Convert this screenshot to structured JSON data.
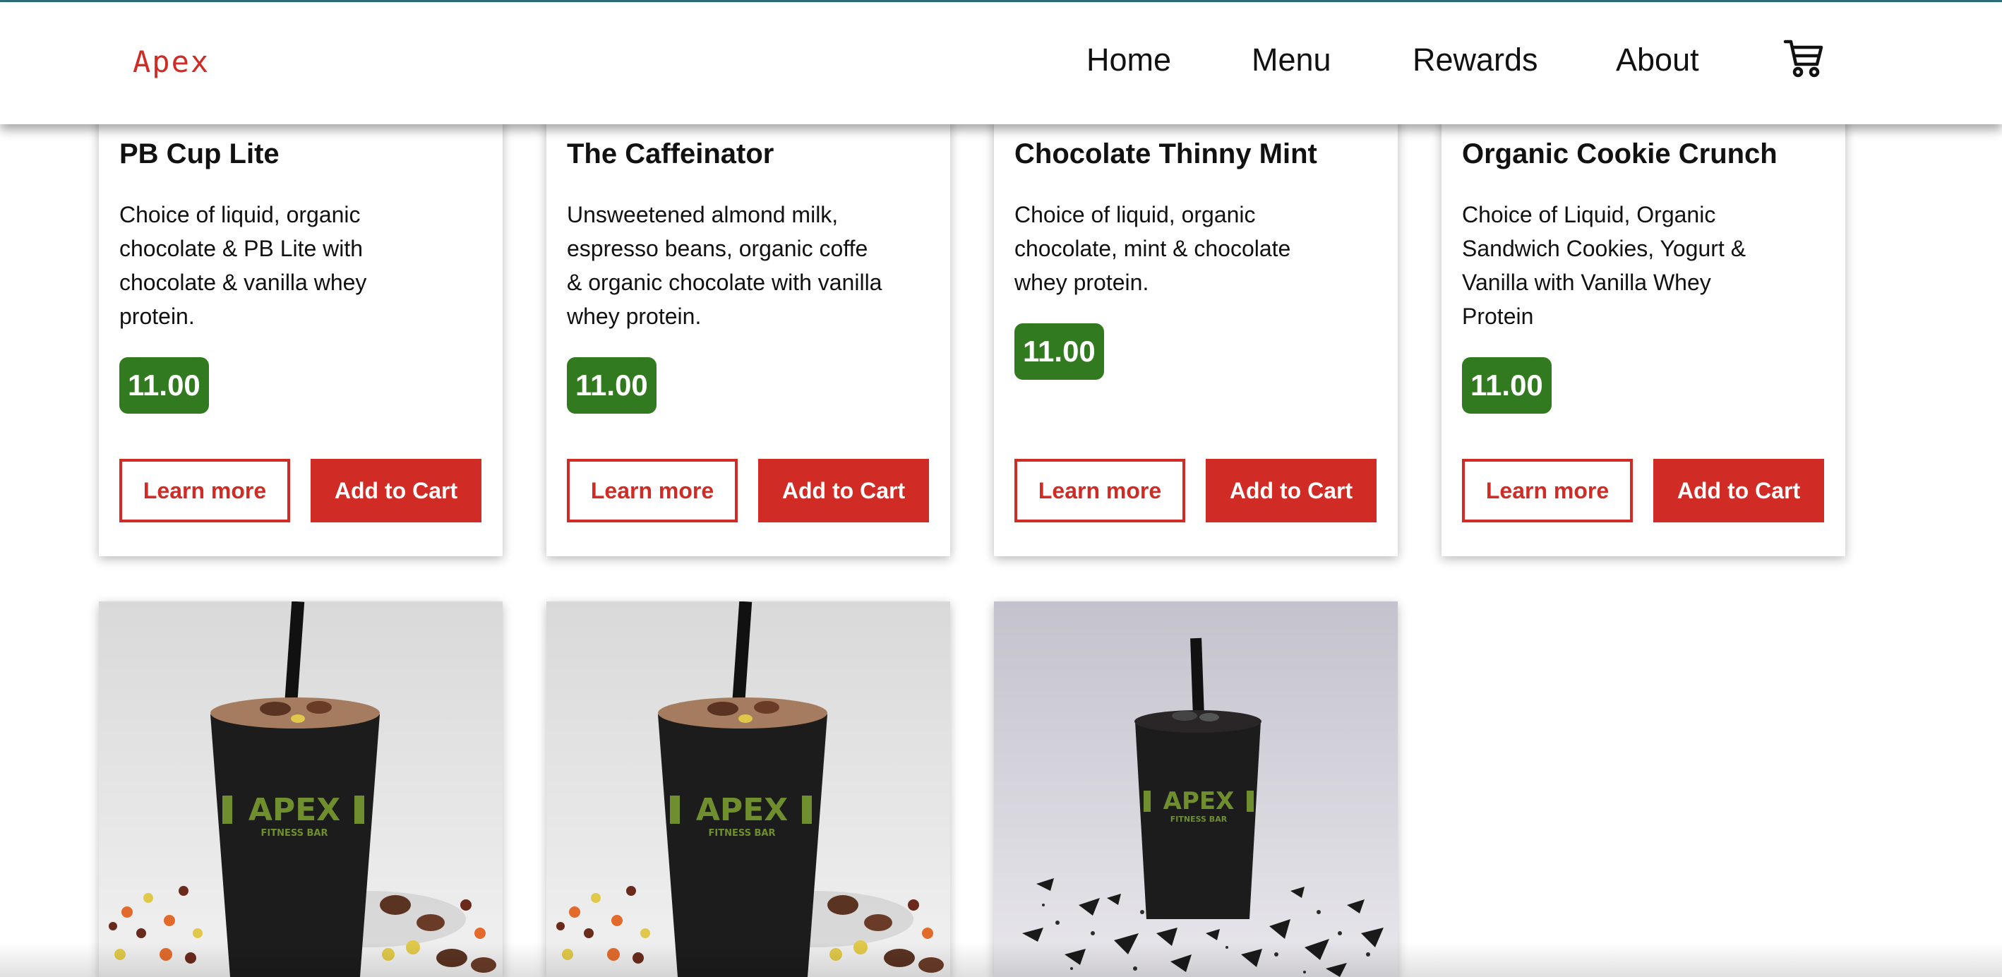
{
  "header": {
    "logo": "Apex",
    "nav": [
      "Home",
      "Menu",
      "Rewards",
      "About"
    ],
    "cart_icon": "shopping-cart-icon"
  },
  "products": [
    {
      "title": "PB Cup Lite",
      "desc_lines": [
        "Choice of liquid, organic",
        "chocolate & PB Lite with",
        "chocolate & vanilla whey",
        "protein."
      ],
      "price": "11.00"
    },
    {
      "title": "The Caffeinator",
      "desc_lines": [
        "Unsweetened almond milk,",
        "espresso beans, organic coffe",
        "& organic chocolate with vanilla",
        "whey protein."
      ],
      "price": "11.00"
    },
    {
      "title": "Chocolate Thinny Mint",
      "desc_lines": [
        "Choice of liquid, organic",
        "chocolate, mint & chocolate",
        "whey protein."
      ],
      "price": "11.00"
    },
    {
      "title": "Organic Cookie Crunch",
      "desc_lines": [
        "Choice of Liquid, Organic",
        "Sandwich Cookies, Yogurt &",
        "Vanilla with Vanilla Whey",
        "Protein"
      ],
      "price": "11.00"
    }
  ],
  "buttons": {
    "learn_more": "Learn more",
    "add_to_cart": "Add to Cart"
  },
  "product_images": [
    {
      "brand": "APEX",
      "sub": "FITNESS BAR",
      "topping": "candy"
    },
    {
      "brand": "APEX",
      "sub": "FITNESS BAR",
      "topping": "candy"
    },
    {
      "brand": "APEX",
      "sub": "FITNESS BAR",
      "topping": "cookie"
    }
  ],
  "colors": {
    "accent": "#d12b25",
    "price_badge": "#327a1f",
    "brand_logo": "#6f8e2e"
  }
}
